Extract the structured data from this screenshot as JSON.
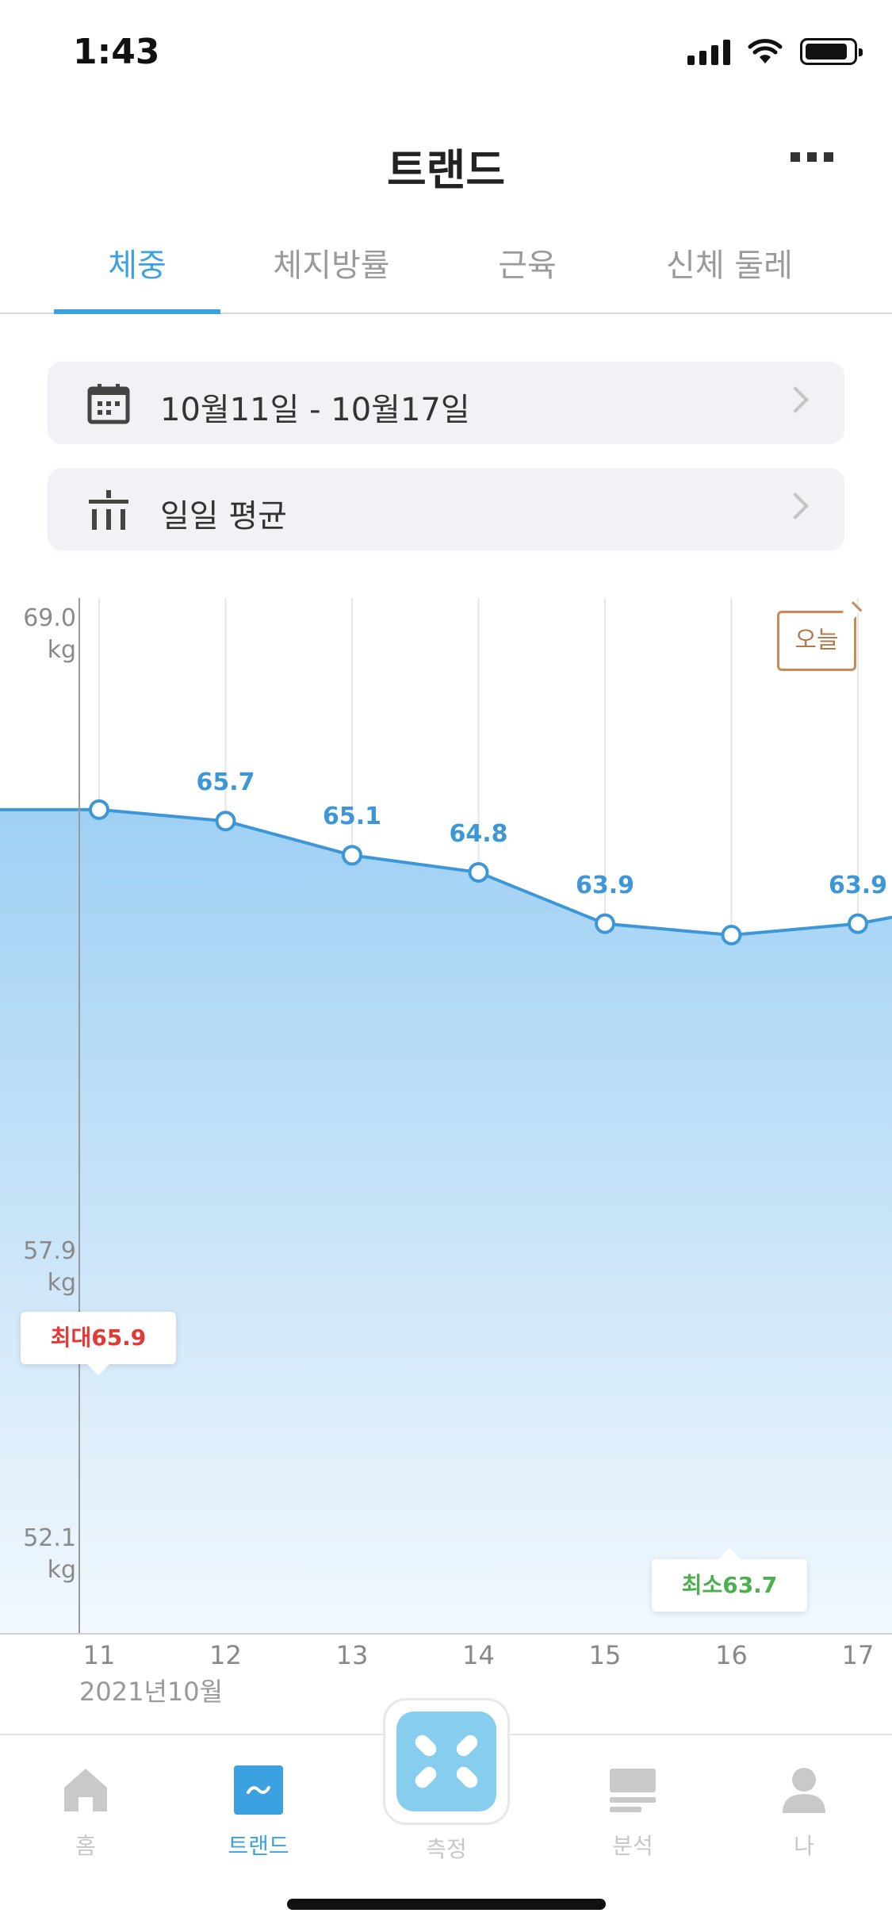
{
  "status_bar": {
    "time": "1:43"
  },
  "header": {
    "title": "트랜드"
  },
  "tabs": [
    {
      "label": "체중",
      "active": true
    },
    {
      "label": "체지방률",
      "active": false
    },
    {
      "label": "근육",
      "active": false
    },
    {
      "label": "신체 둘레",
      "active": false
    }
  ],
  "date_range": {
    "label": "10월11일 - 10월17일",
    "icon": "calendar-icon"
  },
  "aggregation": {
    "label": "일일 평균",
    "icon": "bar-average-icon"
  },
  "chart_data": {
    "type": "area",
    "x": [
      "11",
      "12",
      "13",
      "14",
      "15",
      "16",
      "17"
    ],
    "x_sublabel": "2021년10월",
    "values": [
      65.9,
      65.7,
      65.1,
      64.8,
      63.9,
      63.7,
      63.9
    ],
    "data_labels": [
      "",
      "65.7",
      "65.1",
      "64.8",
      "63.9",
      "",
      "63.9"
    ],
    "y_ticks": [
      {
        "value": 69.0,
        "label": "69.0",
        "unit": "kg"
      },
      {
        "value": 57.9,
        "label": "57.9",
        "unit": "kg"
      },
      {
        "value": 52.1,
        "label": "52.1",
        "unit": "kg"
      }
    ],
    "max_callout": "최대65.9",
    "min_callout": "최소63.7",
    "today_label": "오늘",
    "colors": {
      "line": "#3c96d8",
      "fill_top": "#9fd0f4",
      "fill_bottom": "#f2f8fd",
      "max": "#e53935",
      "min": "#4caf50",
      "today": "#c98a5a"
    }
  },
  "bottom_nav": {
    "items": [
      {
        "label": "홈",
        "icon": "home-icon",
        "active": false
      },
      {
        "label": "트랜드",
        "icon": "trend-icon",
        "active": true
      },
      {
        "label": "측정",
        "icon": "measure-scale-icon",
        "active": false
      },
      {
        "label": "분석",
        "icon": "analysis-icon",
        "active": false
      },
      {
        "label": "나",
        "icon": "profile-icon",
        "active": false
      }
    ]
  },
  "colors": {
    "accent": "#3ca1e0"
  }
}
